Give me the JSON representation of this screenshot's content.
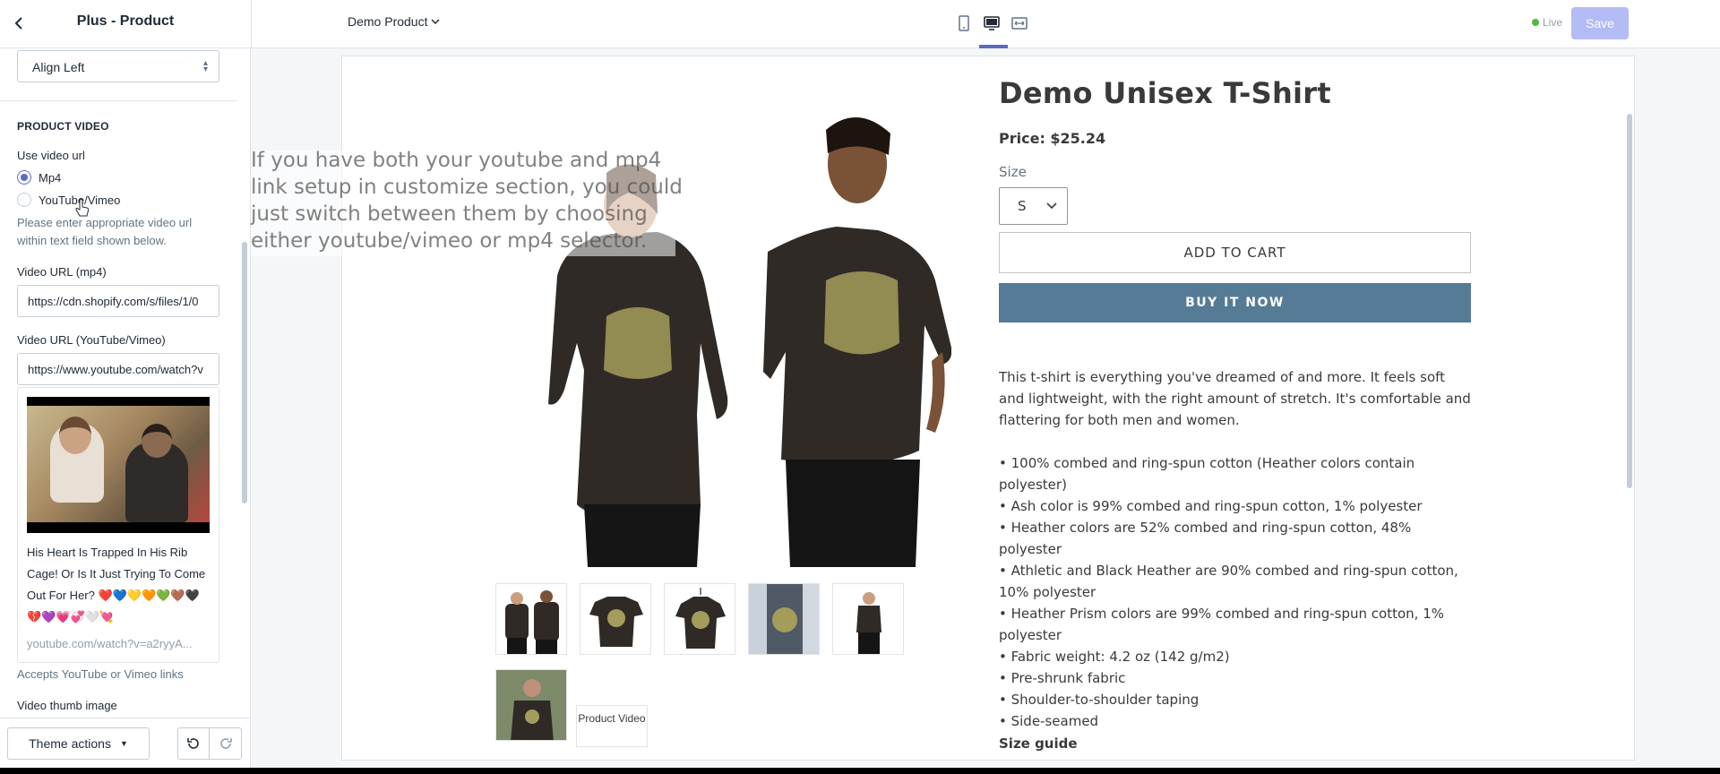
{
  "header": {
    "title": "Plus - Product",
    "page_selector": "Demo Product",
    "live_label": "Live",
    "save_label": "Save",
    "colors": {
      "accent": "#5c6ac4",
      "save_disabled": "#b3bcf5",
      "live": "#50b83c"
    }
  },
  "sidebar": {
    "alignment_select": "Align Left",
    "section_heading": "PRODUCT VIDEO",
    "use_video_url_label": "Use video url",
    "radio_options": [
      {
        "label": "Mp4",
        "checked": true
      },
      {
        "label": "YouTube/Vimeo",
        "checked": false
      }
    ],
    "help_text": "Please enter appropriate video url within text field shown below.",
    "mp4_label": "Video URL (mp4)",
    "mp4_value": "https://cdn.shopify.com/s/files/1/0",
    "youtube_label": "Video URL (YouTube/Vimeo)",
    "youtube_value": "https://www.youtube.com/watch?v",
    "video_card": {
      "title": "His Heart Is Trapped In His Rib Cage! Or Is It Just Trying To Come Out For Her? ❤️💙💛🧡💚🤎🖤💔💜💗💞🤍💘",
      "url": "youtube.com/watch?v=a2ryyA..."
    },
    "accepts_text": "Accepts YouTube or Vimeo links",
    "thumb_label": "Video thumb image",
    "theme_actions_label": "Theme actions"
  },
  "preview": {
    "product_title": "Demo Unisex T-Shirt",
    "price": "Price: $25.24",
    "size_label": "Size",
    "size_value": "S",
    "add_to_cart": "ADD TO CART",
    "buy_now": "BUY IT NOW",
    "description_intro": "This t-shirt is everything you've dreamed of and more. It feels soft and lightweight, with the right amount of stretch. It's comfortable and flattering for both men and women.",
    "features": [
      "• 100% combed and ring-spun cotton (Heather colors contain polyester)",
      "• Ash color is 99% combed and ring-spun cotton, 1% polyester",
      "• Heather colors are 52% combed and ring-spun cotton, 48% polyester",
      "• Athletic and Black Heather are 90% combed and ring-spun cotton, 10% polyester",
      "• Heather Prism colors are 99% combed and ring-spun cotton, 1% polyester",
      "• Fabric weight: 4.2 oz (142 g/m2)",
      "• Pre-shrunk fabric",
      "• Shoulder-to-shoulder taping",
      "• Side-seamed"
    ],
    "size_guide": "Size guide",
    "video_button": "Product Video",
    "buy_button_color": "#557b97"
  },
  "overlay": {
    "tooltip": "If you have both your youtube and mp4 link setup in customize section, you could just switch between them by choosing either youtube/vimeo or mp4 selector."
  }
}
